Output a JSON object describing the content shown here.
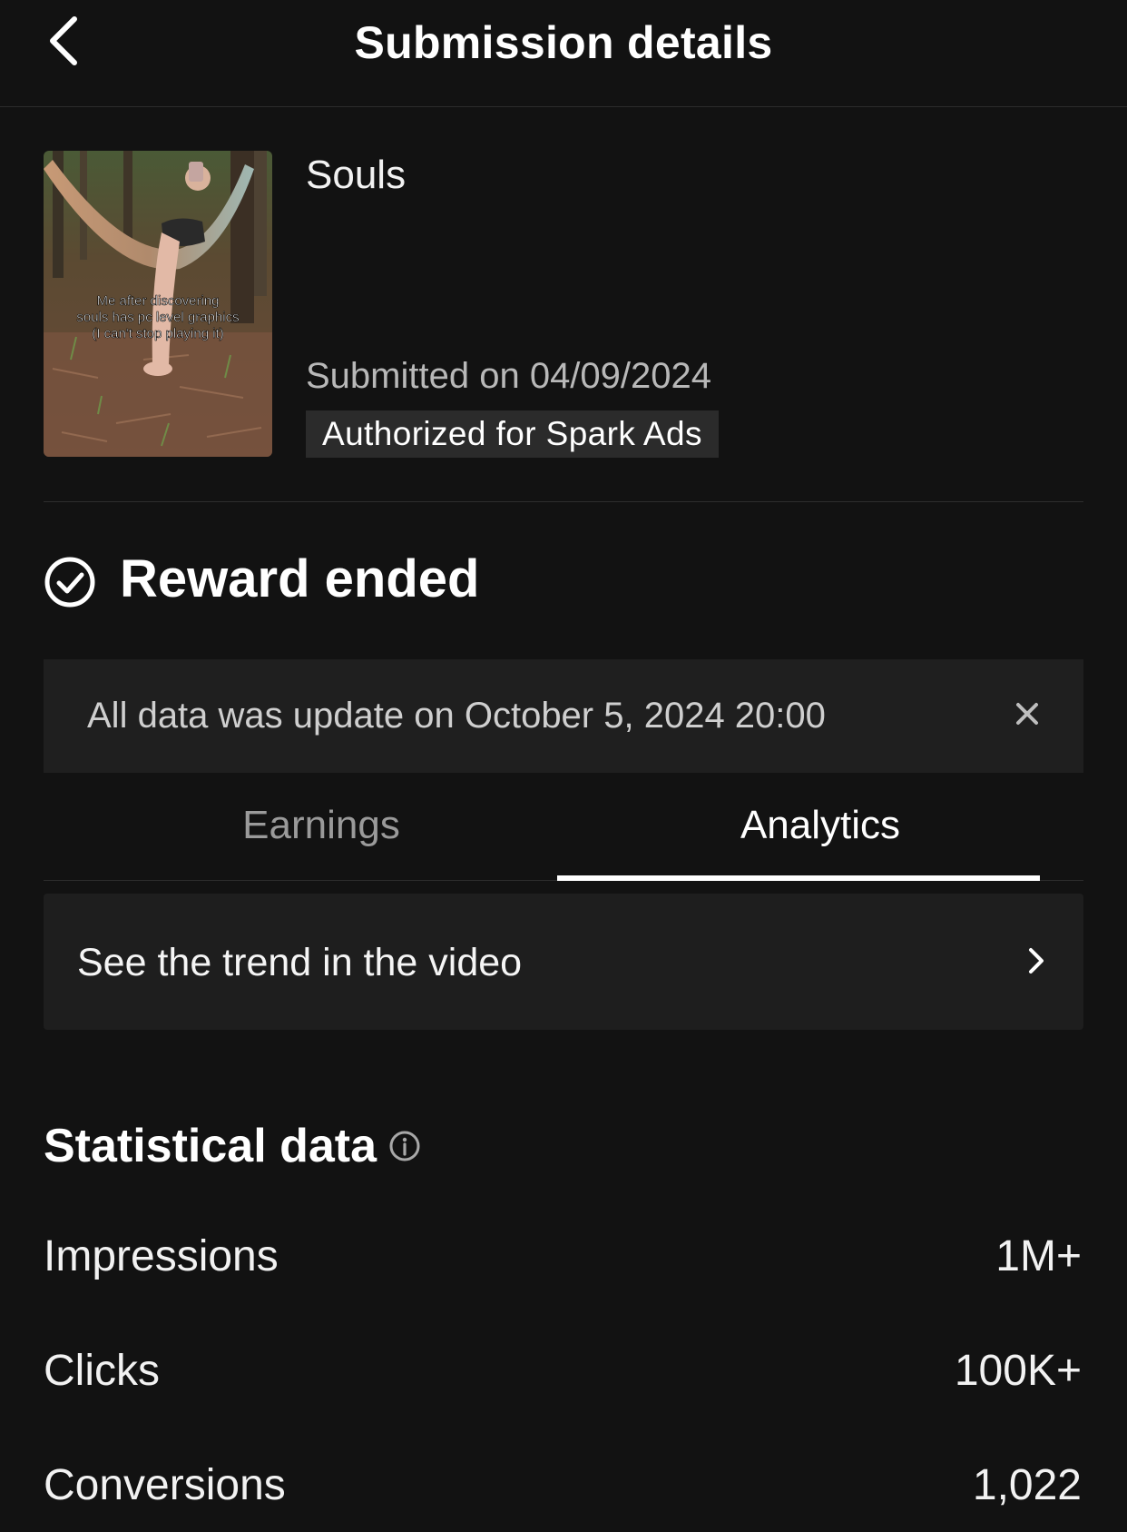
{
  "header": {
    "title": "Submission details",
    "back_icon": "chevron-left-icon"
  },
  "video": {
    "title": "Souls",
    "thumbnail_caption": [
      "Me after discovering",
      "souls has pc level graphics",
      "(I can't stop playing it)"
    ],
    "submitted": "Submitted on 04/09/2024",
    "badge": "Authorized for Spark Ads"
  },
  "reward": {
    "status": "Reward ended",
    "icon": "check-circle-icon"
  },
  "notice": {
    "text": "All data was update on October 5, 2024 20:00",
    "close_icon": "close-icon"
  },
  "tabs": [
    {
      "label": "Earnings",
      "active": false
    },
    {
      "label": "Analytics",
      "active": true
    }
  ],
  "trend": {
    "label": "See the trend in the video",
    "icon": "chevron-right-icon"
  },
  "stats": {
    "title": "Statistical data",
    "info_icon": "info-icon",
    "rows": [
      {
        "label": "Impressions",
        "value": "1M+"
      },
      {
        "label": "Clicks",
        "value": "100K+"
      },
      {
        "label": "Conversions",
        "value": "1,022"
      }
    ]
  },
  "colors": {
    "background": "#121212",
    "panel": "#1f1f1f",
    "text_primary": "#ffffff",
    "text_secondary": "#b8b8b8"
  }
}
